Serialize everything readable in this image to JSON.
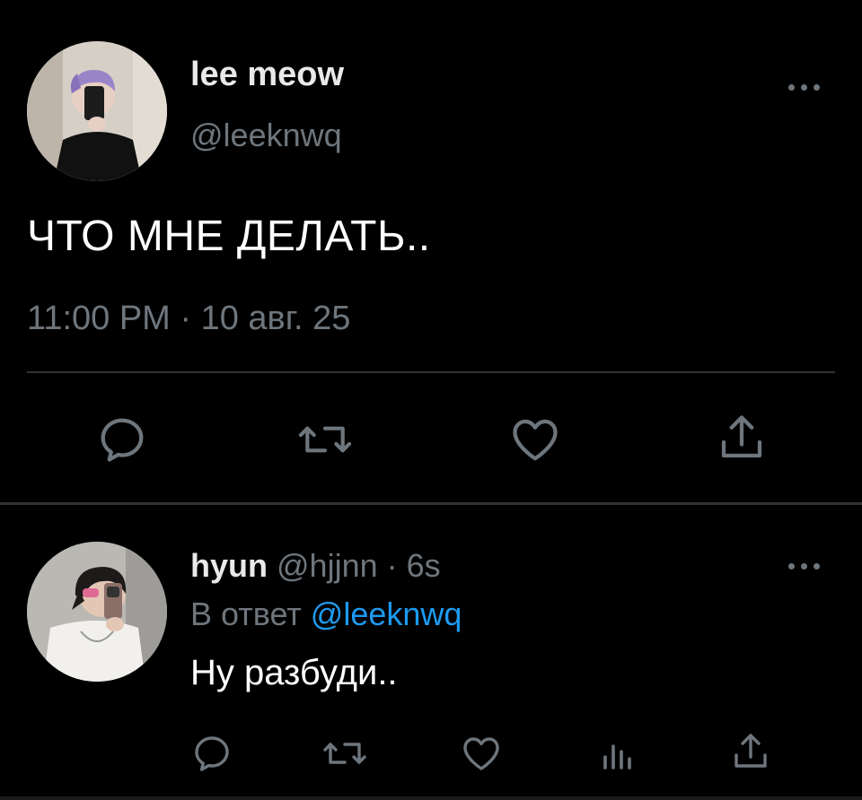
{
  "main_tweet": {
    "display_name": "lee meow",
    "handle": "@leeknwq",
    "text": "ЧТО МНЕ ДЕЛАТЬ..",
    "timestamp": "11:00 PM · 10 авг. 25",
    "avatar_icon": "user-avatar-photo",
    "actions": [
      "reply-icon",
      "retweet-icon",
      "like-icon",
      "share-icon"
    ]
  },
  "reply": {
    "display_name": "hyun",
    "handle": "@hjjnn",
    "separator": "·",
    "time_ago": "6s",
    "reply_to_prefix": "В ответ",
    "reply_to_mention": "@leeknwq",
    "text": "Ну разбуди..",
    "avatar_icon": "user-avatar-photo",
    "actions": [
      "reply-icon",
      "retweet-icon",
      "like-icon",
      "analytics-icon",
      "share-icon"
    ]
  },
  "colors": {
    "background": "#000000",
    "primary_text": "#e7e9ea",
    "secondary_text": "#6e767d",
    "link": "#1d9bf0",
    "divider": "#2f3336",
    "icon": "#6e767d"
  }
}
